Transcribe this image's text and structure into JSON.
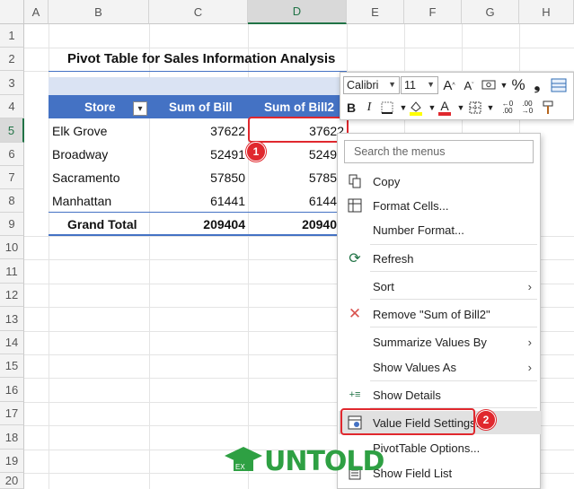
{
  "columns": [
    "A",
    "B",
    "C",
    "D",
    "E",
    "F",
    "G",
    "H"
  ],
  "rows": [
    "1",
    "2",
    "3",
    "4",
    "5",
    "6",
    "7",
    "8",
    "9",
    "10",
    "11",
    "12",
    "13",
    "14",
    "15",
    "16",
    "17",
    "18",
    "19",
    "20"
  ],
  "sheet_title": "Pivot Table for Sales Information Analysis",
  "pivot": {
    "headers": [
      "Store",
      "Sum of Bill",
      "Sum of Bill2"
    ],
    "rows": [
      {
        "store": "Elk Grove",
        "bill": "37622",
        "bill2": "37622"
      },
      {
        "store": "Broadway",
        "bill": "52491",
        "bill2": "5249"
      },
      {
        "store": "Sacramento",
        "bill": "57850",
        "bill2": "5785"
      },
      {
        "store": "Manhattan",
        "bill": "61441",
        "bill2": "6144"
      }
    ],
    "total": {
      "label": "Grand Total",
      "bill": "209404",
      "bill2": "20940"
    }
  },
  "mini_toolbar": {
    "font": "Calibri",
    "size": "11"
  },
  "menu": {
    "search_placeholder": "Search the menus",
    "items": {
      "copy": "Copy",
      "format_cells": "Format Cells...",
      "number_format": "Number Format...",
      "refresh": "Refresh",
      "sort": "Sort",
      "remove": "Remove \"Sum of Bill2\"",
      "summarize": "Summarize Values By",
      "show_values": "Show Values As",
      "show_details": "Show Details",
      "value_field": "Value Field Settings...",
      "pivot_options": "PivotTable Options...",
      "field_list": "Show Field List"
    }
  },
  "badges": {
    "one": "1",
    "two": "2"
  },
  "logo": {
    "text": "UNTOLD"
  },
  "colors": {
    "accent": "#4472c4",
    "highlight": "#e0282e",
    "excel_green": "#217346"
  }
}
